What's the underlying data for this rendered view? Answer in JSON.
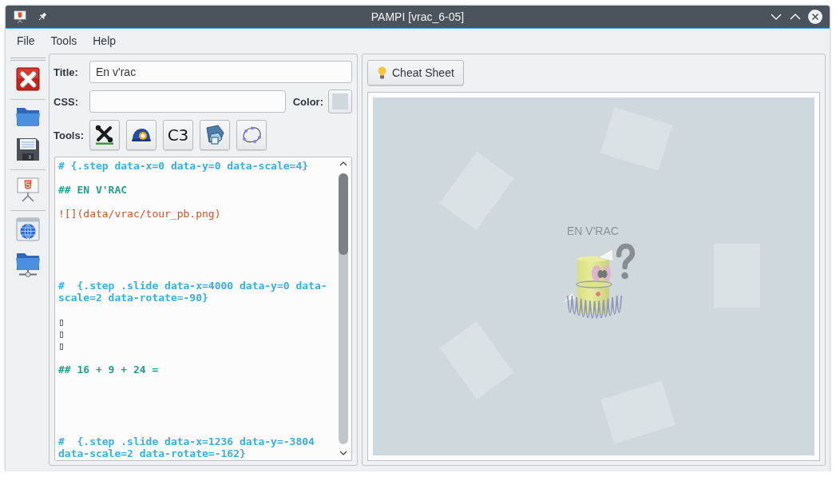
{
  "window": {
    "title": "PAMPI [vrac_6-05]"
  },
  "menu": [
    {
      "label": "File"
    },
    {
      "label": "Tools"
    },
    {
      "label": "Help"
    }
  ],
  "editor": {
    "title_field": {
      "label": "Title:",
      "value": "En v'rac"
    },
    "css_field": {
      "label": "CSS:"
    },
    "color_picker": {
      "label": "Color:",
      "color": "#cfd8dc"
    },
    "tools": {
      "label": "Tools:",
      "buttons": [
        {
          "kind": "icon"
        },
        {
          "kind": "icon"
        },
        {
          "kind": "text",
          "label": "C3"
        },
        {
          "kind": "icon"
        },
        {
          "kind": "icon"
        }
      ]
    },
    "code_lines": [
      {
        "kind": "step",
        "text": "# {.step data-x=0 data-y=0 data-scale=4}"
      },
      {
        "kind": "blank"
      },
      {
        "kind": "heading",
        "text": "## EN V'RAC"
      },
      {
        "kind": "blank"
      },
      {
        "kind": "image",
        "text": "![](data/vrac/tour_pb.png)"
      },
      {
        "kind": "blank"
      },
      {
        "kind": "blank"
      },
      {
        "kind": "blank"
      },
      {
        "kind": "blank"
      },
      {
        "kind": "blank"
      },
      {
        "kind": "step",
        "text": "#  {.step .slide data-x=4000 data-y=0 data-scale=2 data-rotate=-90}"
      },
      {
        "kind": "blank"
      },
      {
        "kind": "text",
        "text": "▯"
      },
      {
        "kind": "text",
        "text": "▯"
      },
      {
        "kind": "text",
        "text": "▯"
      },
      {
        "kind": "blank"
      },
      {
        "kind": "heading",
        "text": "## 16 + 9 + 24 ="
      },
      {
        "kind": "blank"
      },
      {
        "kind": "blank"
      },
      {
        "kind": "blank"
      },
      {
        "kind": "blank"
      },
      {
        "kind": "blank"
      },
      {
        "kind": "step",
        "text": "#  {.step .slide data-x=1236 data-y=-3804 data-scale=2 data-rotate=-162}"
      }
    ]
  },
  "preview": {
    "button": {
      "label": "Cheat Sheet"
    },
    "heading": "EN V'RAC"
  }
}
